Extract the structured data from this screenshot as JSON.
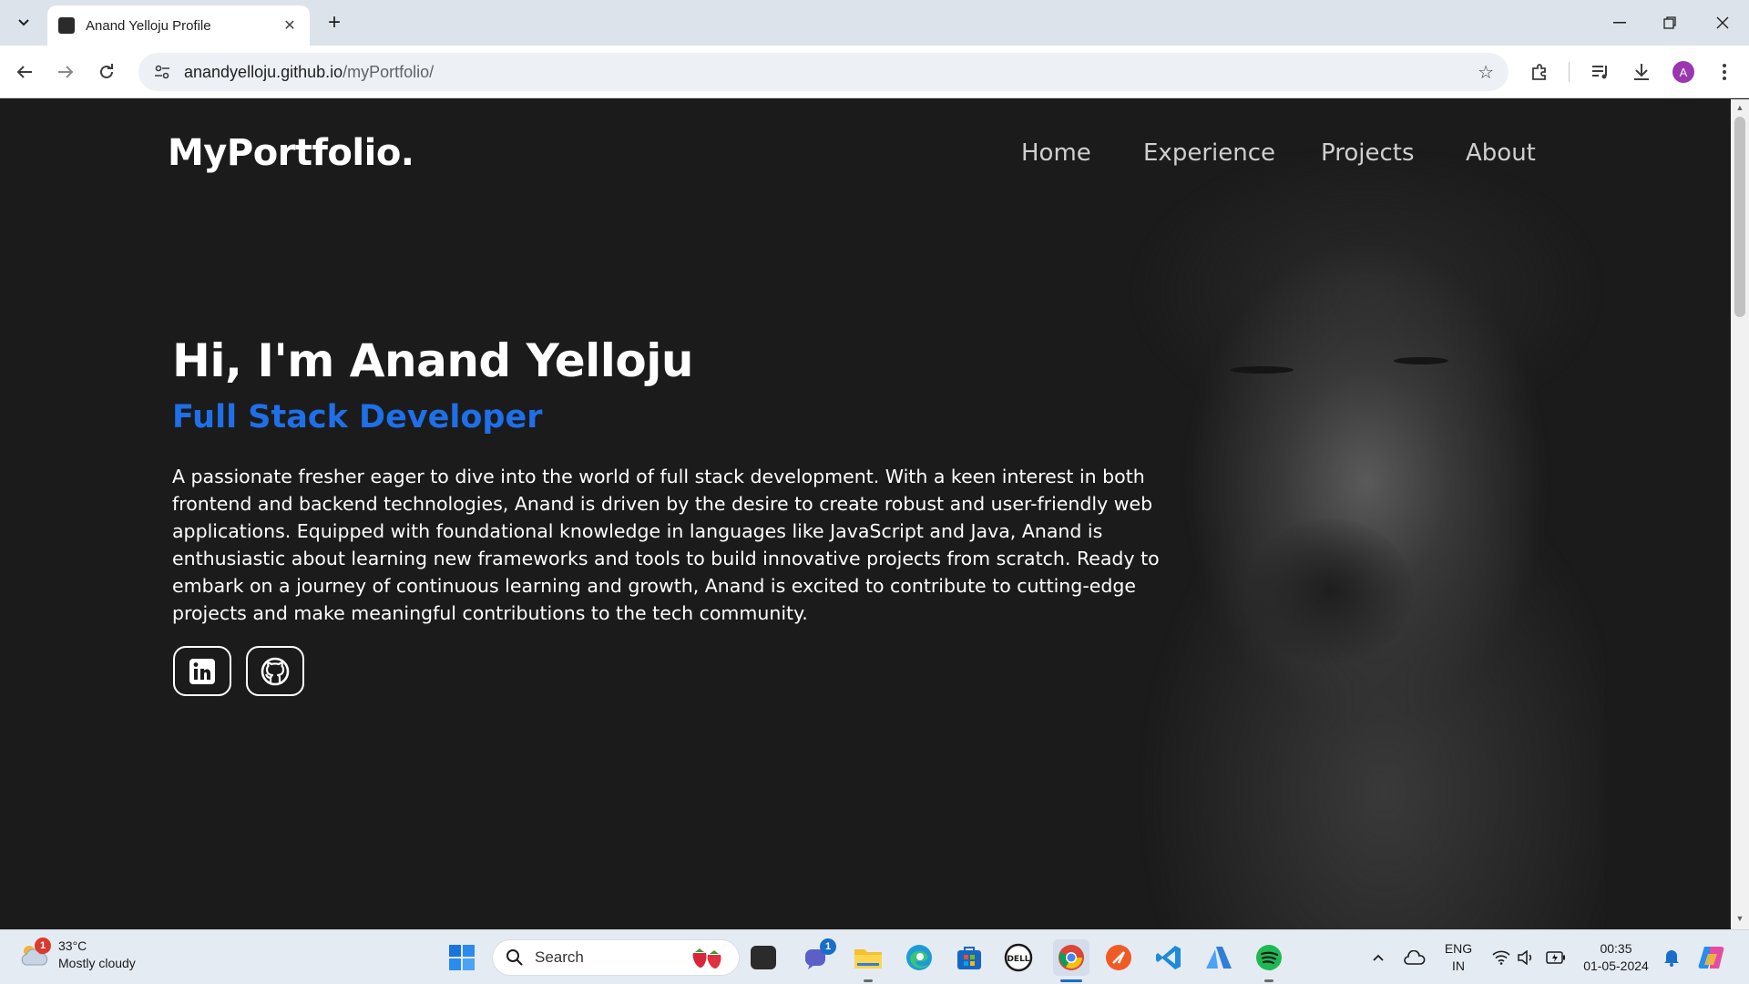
{
  "browser": {
    "tab_title": "Anand Yelloju Profile",
    "url_domain": "anandyelloju.github.io",
    "url_path": "/myPortfolio/",
    "profile_initial": "A"
  },
  "site": {
    "brand": "MyPortfolio.",
    "nav": [
      "Home",
      "Experience",
      "Projects",
      "About"
    ],
    "greeting": "Hi, I'm Anand Yelloju",
    "role": "Full Stack Developer",
    "bio": "A passionate fresher eager to dive into the world of full stack development. With a keen interest in both frontend and backend technologies, Anand is driven by the desire to create robust and user-friendly web applications. Equipped with foundational knowledge in languages like JavaScript and Java, Anand is enthusiastic about learning new frameworks and tools to build innovative projects from scratch. Ready to embark on a journey of continuous learning and growth, Anand is excited to contribute to cutting-edge projects and make meaningful contributions to the tech community.",
    "social": [
      "linkedin-icon",
      "github-icon"
    ],
    "accent_color": "#1f6fe8"
  },
  "taskbar": {
    "weather_temp": "33°C",
    "weather_desc": "Mostly cloudy",
    "weather_badge": "1",
    "search_label": "Search",
    "teams_badge": "1",
    "lang_line1": "ENG",
    "lang_line2": "IN",
    "time": "00:35",
    "date": "01-05-2024"
  }
}
